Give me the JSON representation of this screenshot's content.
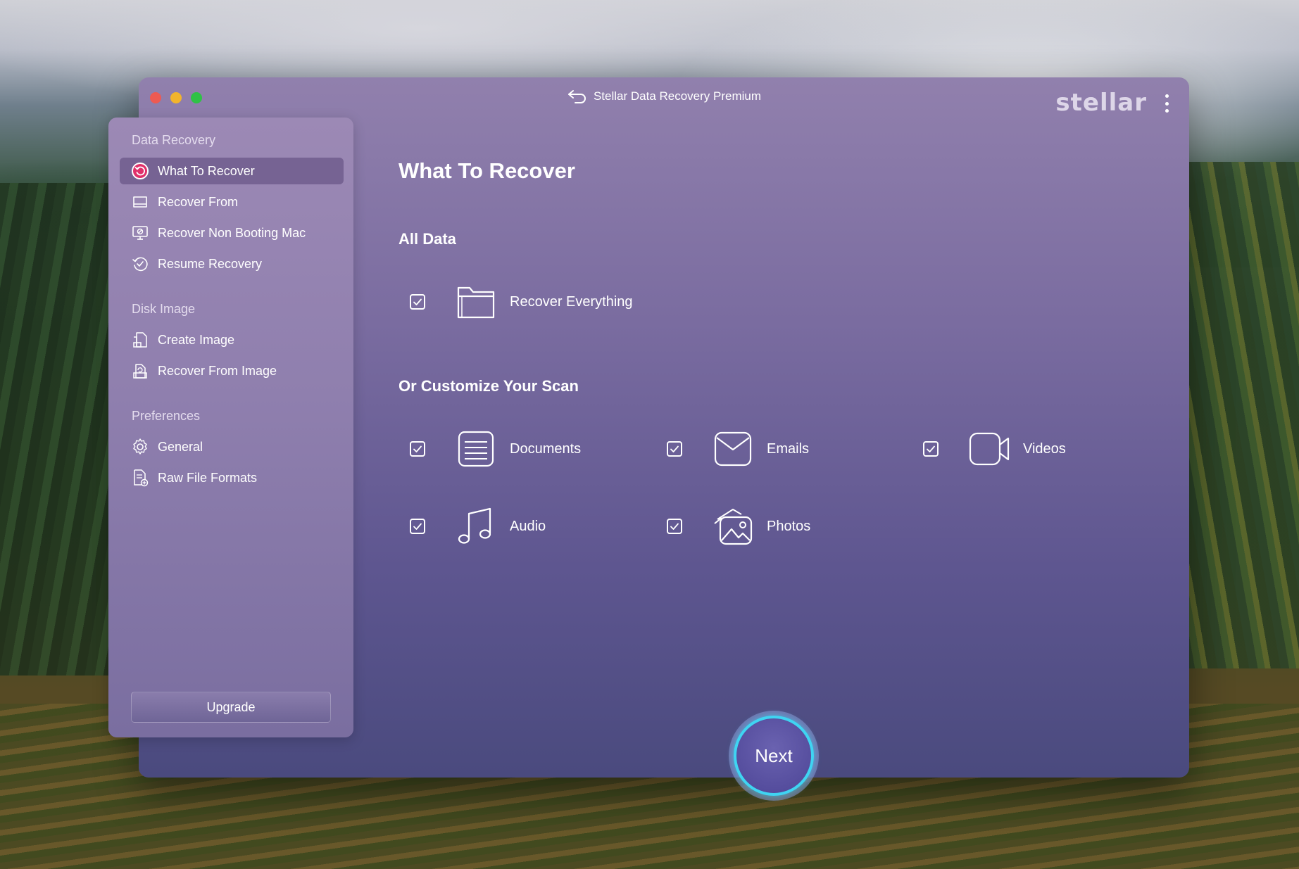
{
  "window": {
    "title": "Stellar Data Recovery Premium",
    "brand": "stellar"
  },
  "sidebar": {
    "sections": [
      {
        "label": "Data Recovery",
        "items": [
          {
            "label": "What To Recover",
            "icon": "undo-circle-icon",
            "active": true
          },
          {
            "label": "Recover From",
            "icon": "drive-icon"
          },
          {
            "label": "Recover Non Booting Mac",
            "icon": "monitor-icon"
          },
          {
            "label": "Resume Recovery",
            "icon": "resume-icon"
          }
        ]
      },
      {
        "label": "Disk Image",
        "items": [
          {
            "label": "Create Image",
            "icon": "create-image-icon"
          },
          {
            "label": "Recover From Image",
            "icon": "recover-image-icon"
          }
        ]
      },
      {
        "label": "Preferences",
        "items": [
          {
            "label": "General",
            "icon": "gear-icon"
          },
          {
            "label": "Raw File Formats",
            "icon": "raw-file-icon"
          }
        ]
      }
    ],
    "upgrade_label": "Upgrade"
  },
  "main": {
    "title": "What To Recover",
    "all_data_heading": "All Data",
    "recover_everything": {
      "label": "Recover Everything",
      "checked": true,
      "icon": "folder-icon"
    },
    "customize_heading": "Or Customize Your Scan",
    "options": [
      {
        "label": "Documents",
        "checked": true,
        "icon": "document-icon"
      },
      {
        "label": "Emails",
        "checked": true,
        "icon": "email-icon"
      },
      {
        "label": "Videos",
        "checked": true,
        "icon": "video-icon"
      },
      {
        "label": "Audio",
        "checked": true,
        "icon": "music-icon"
      },
      {
        "label": "Photos",
        "checked": true,
        "icon": "photos-icon"
      }
    ],
    "next_label": "Next"
  },
  "colors": {
    "accent_ring": "#3fd4f2",
    "active_icon": "#e0306a",
    "window_top": "#9180ad",
    "window_bottom": "#4a4a7e"
  }
}
